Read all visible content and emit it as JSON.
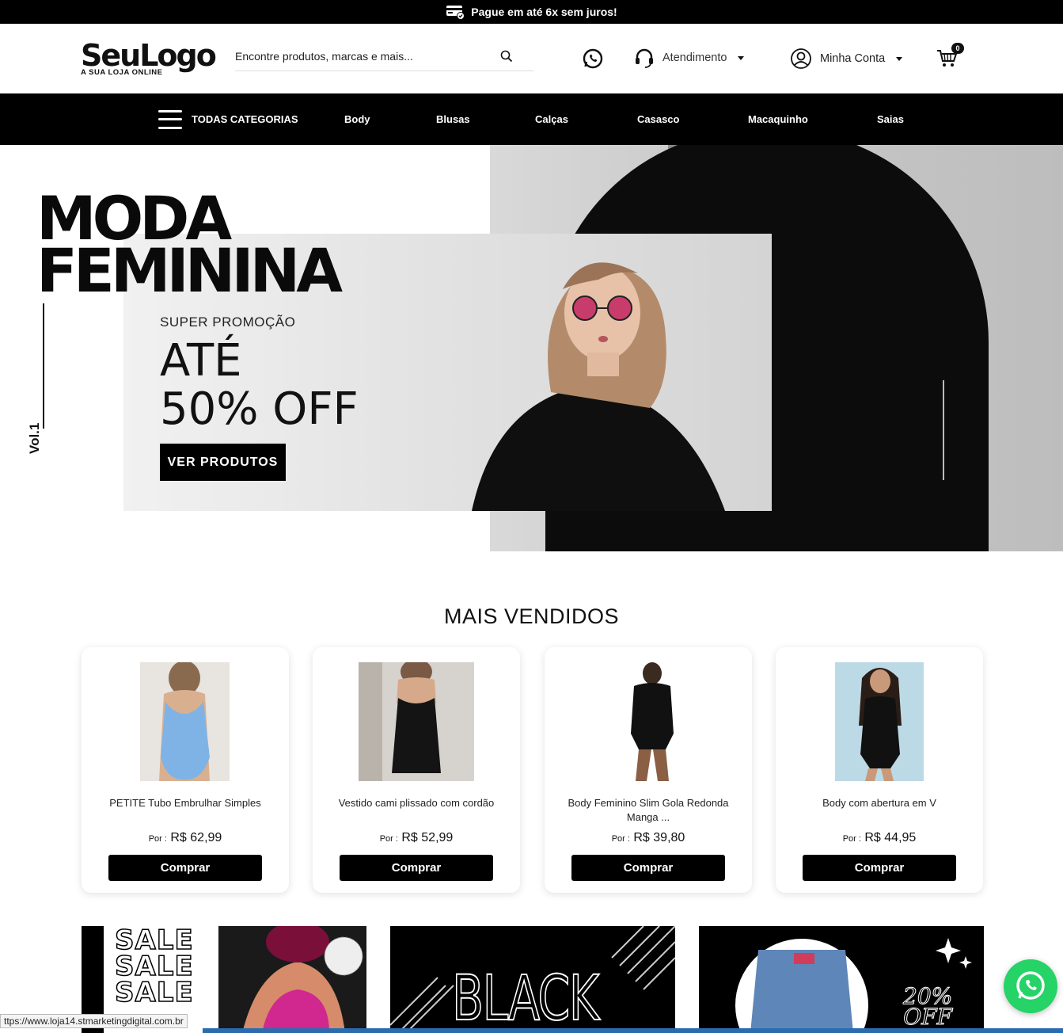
{
  "topbar": {
    "promo_text": "Pague em até 6x sem juros!",
    "icon": "credit-card-icon"
  },
  "header": {
    "logo_main": "SeuLogo",
    "logo_tagline": "A SUA LOJA ONLINE",
    "search_placeholder": "Encontre produtos, marcas e mais...",
    "whatsapp_icon": "whatsapp-icon",
    "support_label": "Atendimento",
    "account_label": "Minha Conta",
    "cart_count": "0"
  },
  "nav": {
    "all_categories": "TODAS CATEGORIAS",
    "items": [
      "Body",
      "Blusas",
      "Calças",
      "Casasco",
      "Macaquinho",
      "Saias"
    ]
  },
  "hero": {
    "title_line1": "MODA",
    "title_line2": "FEMININA",
    "vol": "Vol.1",
    "promo": "SUPER PROMOÇÃO",
    "headline1": "ATÉ",
    "headline2": "50% OFF",
    "cta": "VER PRODUTOS"
  },
  "best_sellers": {
    "title": "MAIS VENDIDOS",
    "products": [
      {
        "name": "PETITE Tubo Embrulhar Simples",
        "por": "Por :",
        "price": "R$ 62,99",
        "buy": "Comprar",
        "color": "#7fb3e6"
      },
      {
        "name": "Vestido cami plissado com cordão",
        "por": "Por :",
        "price": "R$ 52,99",
        "buy": "Comprar",
        "color": "#111111"
      },
      {
        "name": "Body Feminino Slim Gola Redonda Manga ...",
        "por": "Por :",
        "price": "R$ 39,80",
        "buy": "Comprar",
        "color": "#111111"
      },
      {
        "name": "Body com abertura em V",
        "por": "Por :",
        "price": "R$ 44,95",
        "buy": "Comprar",
        "color": "#111111"
      }
    ]
  },
  "banners": {
    "sale_word": "SALE",
    "black_word": "BLACK",
    "discount": "20%",
    "discount_word": "OFF"
  },
  "status_url": "ttps://www.loja14.stmarketingdigital.com.br"
}
